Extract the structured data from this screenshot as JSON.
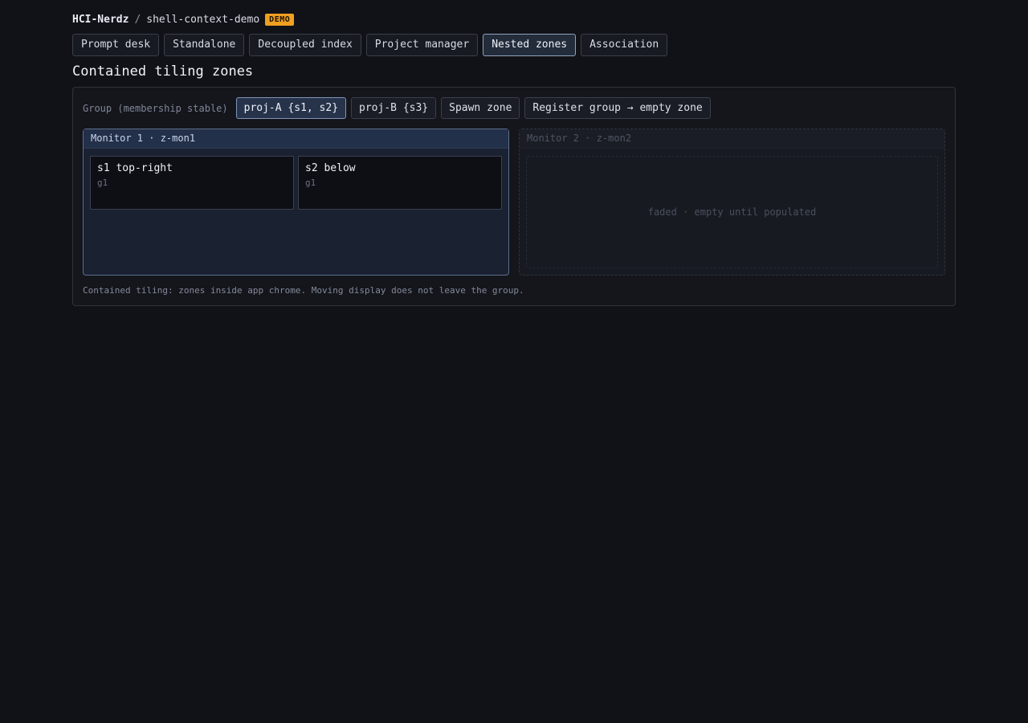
{
  "breadcrumb": {
    "org": "HCI-Nerdz",
    "separator": "/",
    "repo": "shell-context-demo",
    "badge": "DEMO"
  },
  "tabs": [
    {
      "label": "Prompt desk",
      "active": false
    },
    {
      "label": "Standalone",
      "active": false
    },
    {
      "label": "Decoupled index",
      "active": false
    },
    {
      "label": "Project manager",
      "active": false
    },
    {
      "label": "Nested zones",
      "active": true
    },
    {
      "label": "Association",
      "active": false
    }
  ],
  "page_title": "Contained tiling zones",
  "group": {
    "label": "Group (membership stable)",
    "buttons": [
      {
        "label": "proj-A {s1, s2}",
        "active": true
      },
      {
        "label": "proj-B {s3}",
        "active": false
      },
      {
        "label": "Spawn zone",
        "active": false
      },
      {
        "label": "Register group → empty zone",
        "active": false
      }
    ]
  },
  "monitors": [
    {
      "title": "Monitor 1 · z-mon1",
      "tiles": [
        {
          "title": "s1 top-right",
          "sub": "g1"
        },
        {
          "title": "s2 below",
          "sub": "g1"
        }
      ]
    },
    {
      "title": "Monitor 2 · z-mon2",
      "empty_text": "faded · empty until populated"
    }
  ],
  "footnote": "Contained tiling: zones inside app chrome. Moving display does not leave the group.",
  "colors": {
    "background": "#111217",
    "badge": "#f0a020",
    "active_border": "#8ea3c0"
  }
}
